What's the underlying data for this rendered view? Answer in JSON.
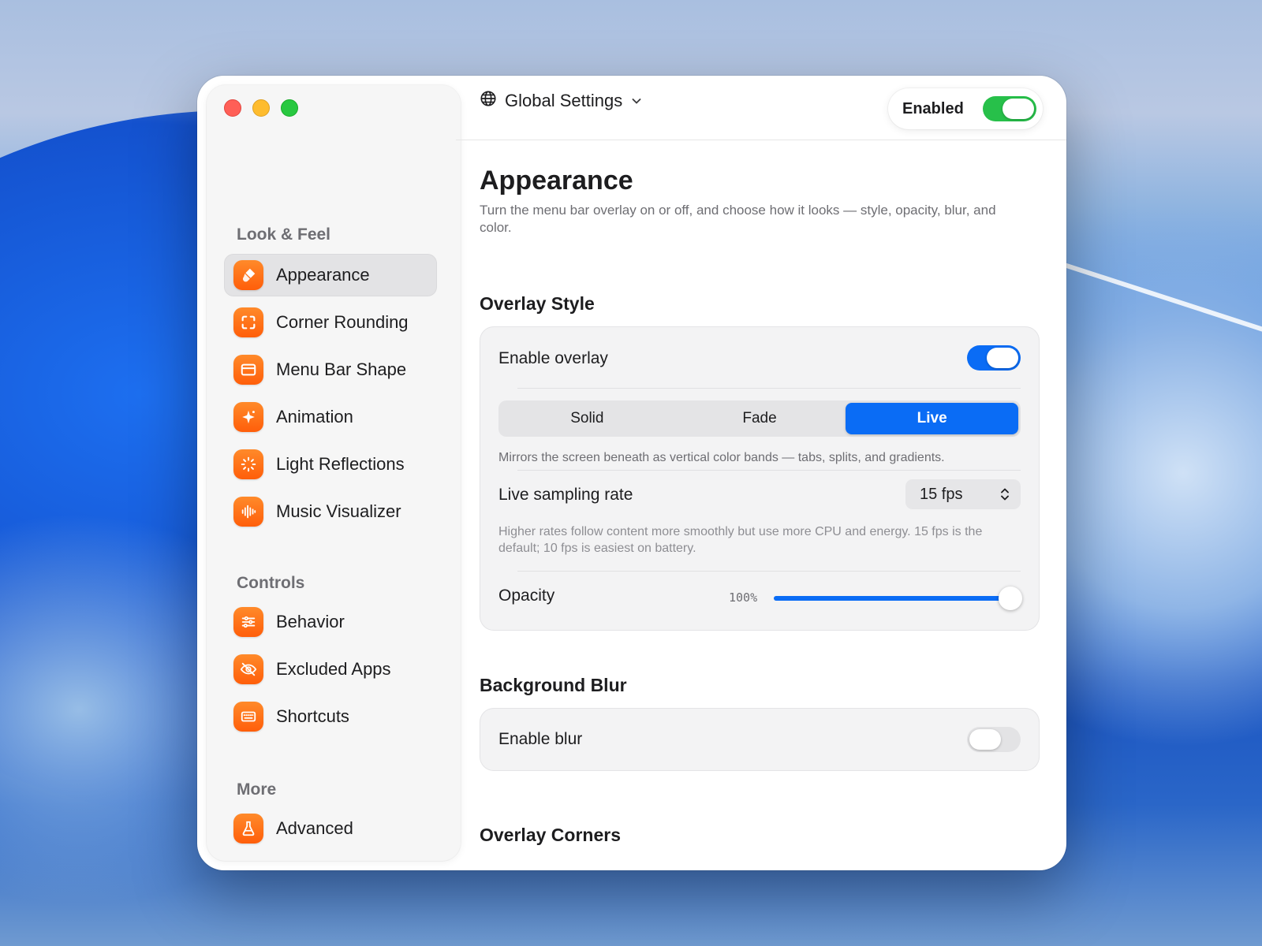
{
  "window": {
    "traffic_lights": [
      "close",
      "minimize",
      "zoom"
    ]
  },
  "sidebar": {
    "sections": [
      {
        "title": "Look & Feel",
        "items": [
          {
            "label": "Appearance",
            "icon": "paintbrush-icon",
            "active": true
          },
          {
            "label": "Corner Rounding",
            "icon": "corners-icon",
            "active": false
          },
          {
            "label": "Menu Bar Shape",
            "icon": "menubar-icon",
            "active": false
          },
          {
            "label": "Animation",
            "icon": "sparkle-icon",
            "active": false
          },
          {
            "label": "Light Reflections",
            "icon": "sun-rays-icon",
            "active": false
          },
          {
            "label": "Music Visualizer",
            "icon": "waveform-icon",
            "active": false
          }
        ]
      },
      {
        "title": "Controls",
        "items": [
          {
            "label": "Behavior",
            "icon": "sliders-icon",
            "active": false
          },
          {
            "label": "Excluded Apps",
            "icon": "eye-slash-icon",
            "active": false
          },
          {
            "label": "Shortcuts",
            "icon": "keyboard-icon",
            "active": false
          }
        ]
      },
      {
        "title": "More",
        "items": [
          {
            "label": "Advanced",
            "icon": "flask-icon",
            "active": false
          }
        ]
      }
    ]
  },
  "topbar": {
    "scope_label": "Global Settings",
    "enabled_label": "Enabled",
    "enabled": true
  },
  "page": {
    "title": "Appearance",
    "subtitle": "Turn the menu bar overlay on or off, and choose how it looks — style, opacity, blur, and color."
  },
  "overlay_style": {
    "title": "Overlay Style",
    "enable_label": "Enable overlay",
    "enabled": true,
    "modes": [
      "Solid",
      "Fade",
      "Live"
    ],
    "selected_mode": "Live",
    "mode_hint": "Mirrors the screen beneath as vertical color bands — tabs, splits, and gradients.",
    "sampling_label": "Live sampling rate",
    "sampling_value": "15 fps",
    "sampling_hint": "Higher rates follow content more smoothly but use more CPU and energy. 15 fps is the default; 10 fps is easiest on battery.",
    "opacity_label": "Opacity",
    "opacity_value_text": "100%",
    "opacity_fraction": 1.0
  },
  "background_blur": {
    "title": "Background Blur",
    "enable_label": "Enable blur",
    "enabled": false
  },
  "overlay_corners": {
    "title": "Overlay Corners"
  },
  "colors": {
    "accent_blue": "#0a6cf5",
    "toggle_green": "#27c04a",
    "icon_orange": "#ff6a12"
  }
}
